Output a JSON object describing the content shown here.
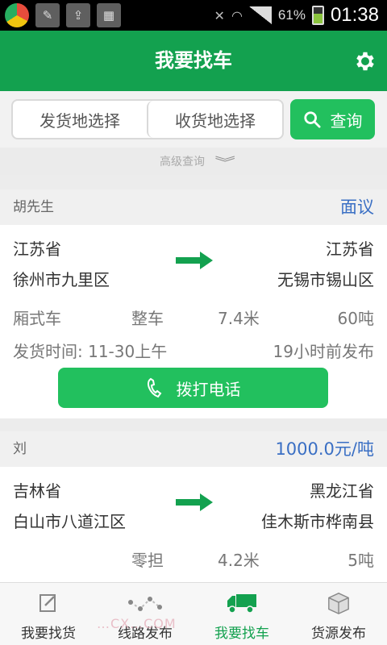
{
  "status_bar": {
    "battery": "61%",
    "time": "01:38"
  },
  "header": {
    "title": "我要找车"
  },
  "search": {
    "origin": "发货地选择",
    "destination": "收货地选择",
    "query": "查询"
  },
  "advanced": {
    "label": "高级查询"
  },
  "cards": [
    {
      "name": "胡先生",
      "price": "面议",
      "from_province": "江苏省",
      "from_city": "徐州市九里区",
      "to_province": "江苏省",
      "to_city": "无锡市锡山区",
      "truck_type": "厢式车",
      "load_type": "整车",
      "length": "7.4米",
      "weight": "60吨",
      "ship_time": "发货时间: 11-30上午",
      "posted": "19小时前发布",
      "call": "拨打电话"
    },
    {
      "name": "刘",
      "price": "1000.0元/吨",
      "from_province": "吉林省",
      "from_city": "白山市八道江区",
      "to_province": "黑龙江省",
      "to_city": "佳木斯市桦南县",
      "load_type": "零担",
      "length": "4.2米",
      "weight": "5吨"
    }
  ],
  "nav": [
    {
      "label": "我要找货",
      "icon": "edit-icon"
    },
    {
      "label": "线路发布",
      "icon": "route-icon"
    },
    {
      "label": "我要找车",
      "icon": "truck-icon"
    },
    {
      "label": "货源发布",
      "icon": "box-icon"
    }
  ],
  "watermark": "…CX…COM",
  "colors": {
    "primary": "#13a14f",
    "button": "#22c05e",
    "price": "#3a6fc4"
  }
}
